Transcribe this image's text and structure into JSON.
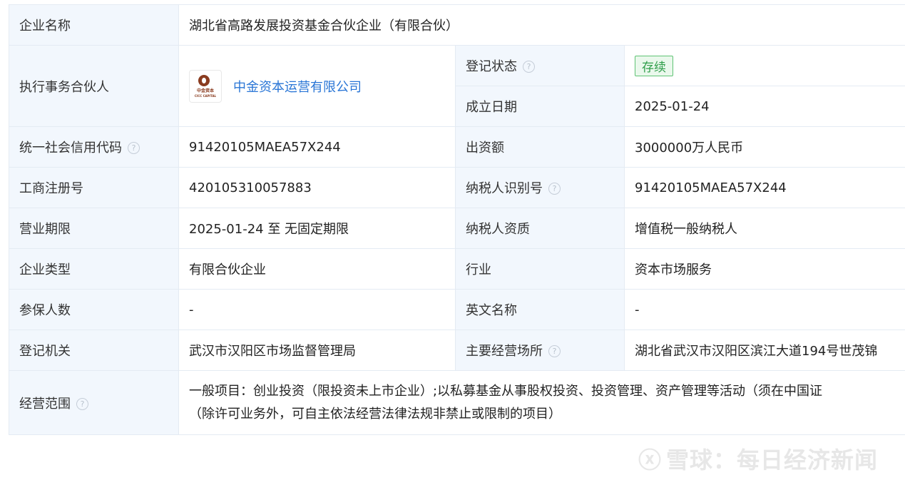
{
  "company_name": {
    "label": "企业名称",
    "value": "湖北省高路发展投资基金合伙企业（有限合伙）"
  },
  "partner": {
    "label": "执行事务合伙人",
    "logo_text": "中金资本",
    "logo_subtext": "CICC CAPITAL",
    "name": "中金资本运营有限公司"
  },
  "status": {
    "label": "登记状态",
    "value": "存续"
  },
  "founded": {
    "label": "成立日期",
    "value": "2025-01-24"
  },
  "credit_code": {
    "label": "统一社会信用代码",
    "value": "91420105MAEA57X244"
  },
  "capital": {
    "label": "出资额",
    "value": "3000000万人民币"
  },
  "reg_no": {
    "label": "工商注册号",
    "value": "420105310057883"
  },
  "taxpayer_id": {
    "label": "纳税人识别号",
    "value": "91420105MAEA57X244"
  },
  "term": {
    "label": "营业期限",
    "value": "2025-01-24 至 无固定期限"
  },
  "tax_qual": {
    "label": "纳税人资质",
    "value": "增值税一般纳税人"
  },
  "company_type": {
    "label": "企业类型",
    "value": "有限合伙企业"
  },
  "industry": {
    "label": "行业",
    "value": "资本市场服务"
  },
  "insured": {
    "label": "参保人数",
    "value": "-"
  },
  "english_name": {
    "label": "英文名称",
    "value": "-"
  },
  "authority": {
    "label": "登记机关",
    "value": "武汉市汉阳区市场监督管理局"
  },
  "address": {
    "label": "主要经营场所",
    "value": "湖北省武汉市汉阳区滨江大道194号世茂锦"
  },
  "scope": {
    "label": "经营范围",
    "line1": "一般项目：创业投资（限投资未上市企业）;以私募基金从事股权投资、投资管理、资产管理等活动（须在中国证",
    "line2": "（除许可业务外，可自主依法经营法律法规非禁止或限制的项目）"
  },
  "help_glyph": "?",
  "watermark": {
    "logo": "ⓧ",
    "text": "雪球：每日经济新闻"
  },
  "colors": {
    "label_bg": "#f2f7fd",
    "border": "#e4ebf3",
    "link": "#2a76d6",
    "badge_green": "#2f9e4a"
  }
}
